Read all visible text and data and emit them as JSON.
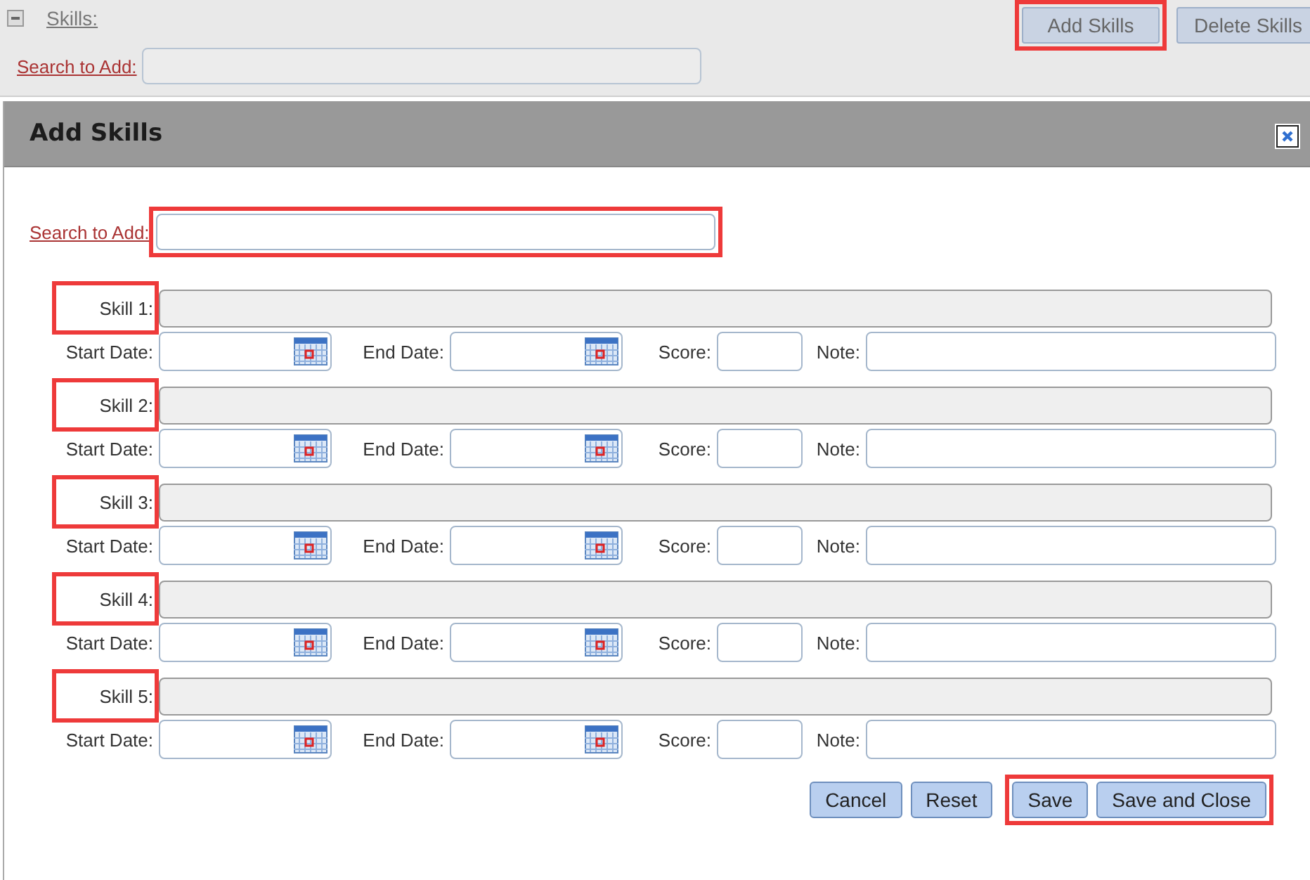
{
  "page": {
    "section_title": "Skills:",
    "search": {
      "label": "Search to Add:"
    },
    "buttons": [
      {
        "label": "Add Skills",
        "highlighted": true
      },
      {
        "label": "Delete Skills",
        "highlighted": false
      }
    ]
  },
  "dialog": {
    "title": "Add Skills",
    "search": {
      "label": "Search to Add:",
      "highlighted": true
    },
    "skills": [
      {
        "label": "Skill 1:",
        "highlighted": true,
        "start_label": "Start Date:",
        "end_label": "End Date:",
        "score_label": "Score:",
        "note_label": "Note:"
      },
      {
        "label": "Skill 2:",
        "highlighted": true,
        "start_label": "Start Date:",
        "end_label": "End Date:",
        "score_label": "Score:",
        "note_label": "Note:"
      },
      {
        "label": "Skill 3:",
        "highlighted": true,
        "start_label": "Start Date:",
        "end_label": "End Date:",
        "score_label": "Score:",
        "note_label": "Note:"
      },
      {
        "label": "Skill 4:",
        "highlighted": true,
        "start_label": "Start Date:",
        "end_label": "End Date:",
        "score_label": "Score:",
        "note_label": "Note:"
      },
      {
        "label": "Skill 5:",
        "highlighted": true,
        "start_label": "Start Date:",
        "end_label": "End Date:",
        "score_label": "Score:",
        "note_label": "Note:"
      }
    ],
    "buttons": [
      {
        "label": "Cancel",
        "highlighted": false
      },
      {
        "label": "Reset",
        "highlighted": false
      },
      {
        "label": "Save",
        "highlighted": true
      },
      {
        "label": "Save and Close",
        "highlighted": true
      }
    ]
  }
}
